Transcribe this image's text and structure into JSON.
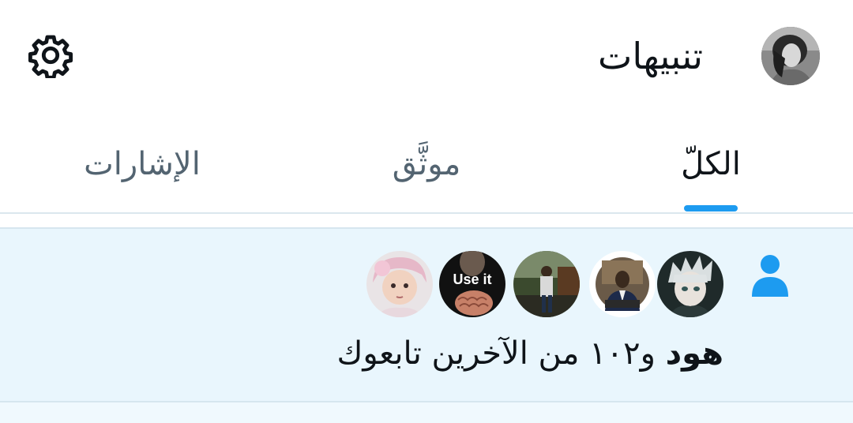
{
  "header": {
    "title": "تنبيهات",
    "settings_icon": "gear-icon",
    "profile_avatar": "profile-avatar"
  },
  "tabs": [
    {
      "label": "الكلّ",
      "active": true
    },
    {
      "label": "موثَّق",
      "active": false
    },
    {
      "label": "الإشارات",
      "active": false
    }
  ],
  "notification": {
    "icon": "person-icon",
    "name": "هود",
    "rest": "و١٠٢ من الآخرين تابعوك",
    "avatars": [
      {
        "name": "anime-character-avatar"
      },
      {
        "name": "man-in-suit-avatar"
      },
      {
        "name": "man-on-bench-avatar"
      },
      {
        "name": "use-it-brain-avatar",
        "text": "Use it"
      },
      {
        "name": "baby-avatar"
      }
    ]
  },
  "colors": {
    "accent": "#1d9bf0",
    "highlight_bg": "#e9f6fd",
    "text": "#0f1419",
    "secondary_text": "#536471"
  }
}
